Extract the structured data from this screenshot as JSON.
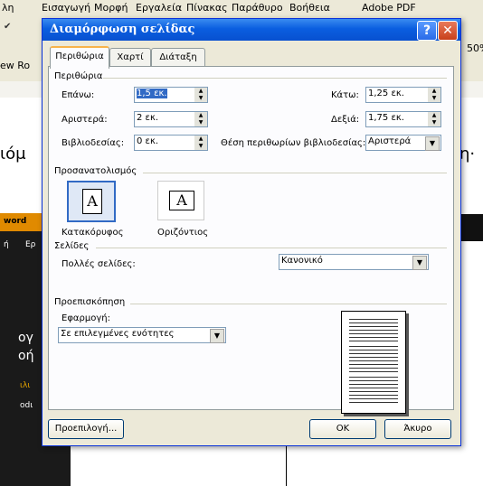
{
  "background": {
    "menu": [
      "λη",
      "Εισαγωγή",
      "Μορφή",
      "Εργαλεία",
      "Πίνακας",
      "Παράθυρο",
      "Βοήθεια",
      "Adobe PDF"
    ],
    "zoom": "50%",
    "left_frag": "ιόμ",
    "right_frag": "η·",
    "toolbar_frag": "ew Ro",
    "panel_title": "word",
    "panel_text": [
      "ή",
      "Ερ",
      "ογ",
      "οή",
      "ιλι",
      "οdι"
    ]
  },
  "dialog": {
    "title": "Διαμόρφωση σελίδας",
    "help": "?",
    "close": "✕",
    "tabs": [
      "Περιθώρια",
      "Χαρτί",
      "Διάταξη"
    ],
    "margins": {
      "group": "Περιθώρια",
      "top_label": "Επάνω:",
      "top_value": "1,5 εκ.",
      "bottom_label": "Κάτω:",
      "bottom_value": "1,25 εκ.",
      "left_label": "Αριστερά:",
      "left_value": "2 εκ.",
      "right_label": "Δεξιά:",
      "right_value": "1,75 εκ.",
      "gutter_label": "Βιβλιοδεσίας:",
      "gutter_value": "0 εκ.",
      "gutter_pos_label": "Θέση περιθωρίων βιβλιοδεσίας:",
      "gutter_pos_value": "Αριστερά"
    },
    "orientation": {
      "group": "Προσανατολισμός",
      "portrait": "Κατακόρυφος",
      "landscape": "Οριζόντιος",
      "glyph": "A"
    },
    "pages": {
      "group": "Σελίδες",
      "multiple_label": "Πολλές σελίδες:",
      "multiple_value": "Κανονικό"
    },
    "preview": {
      "group": "Προεπισκόπηση",
      "apply_label": "Εφαρμογή:",
      "apply_value": "Σε επιλεγμένες ενότητες"
    },
    "buttons": {
      "default": "Προεπιλογή...",
      "ok": "OK",
      "cancel": "Άκυρο"
    }
  }
}
